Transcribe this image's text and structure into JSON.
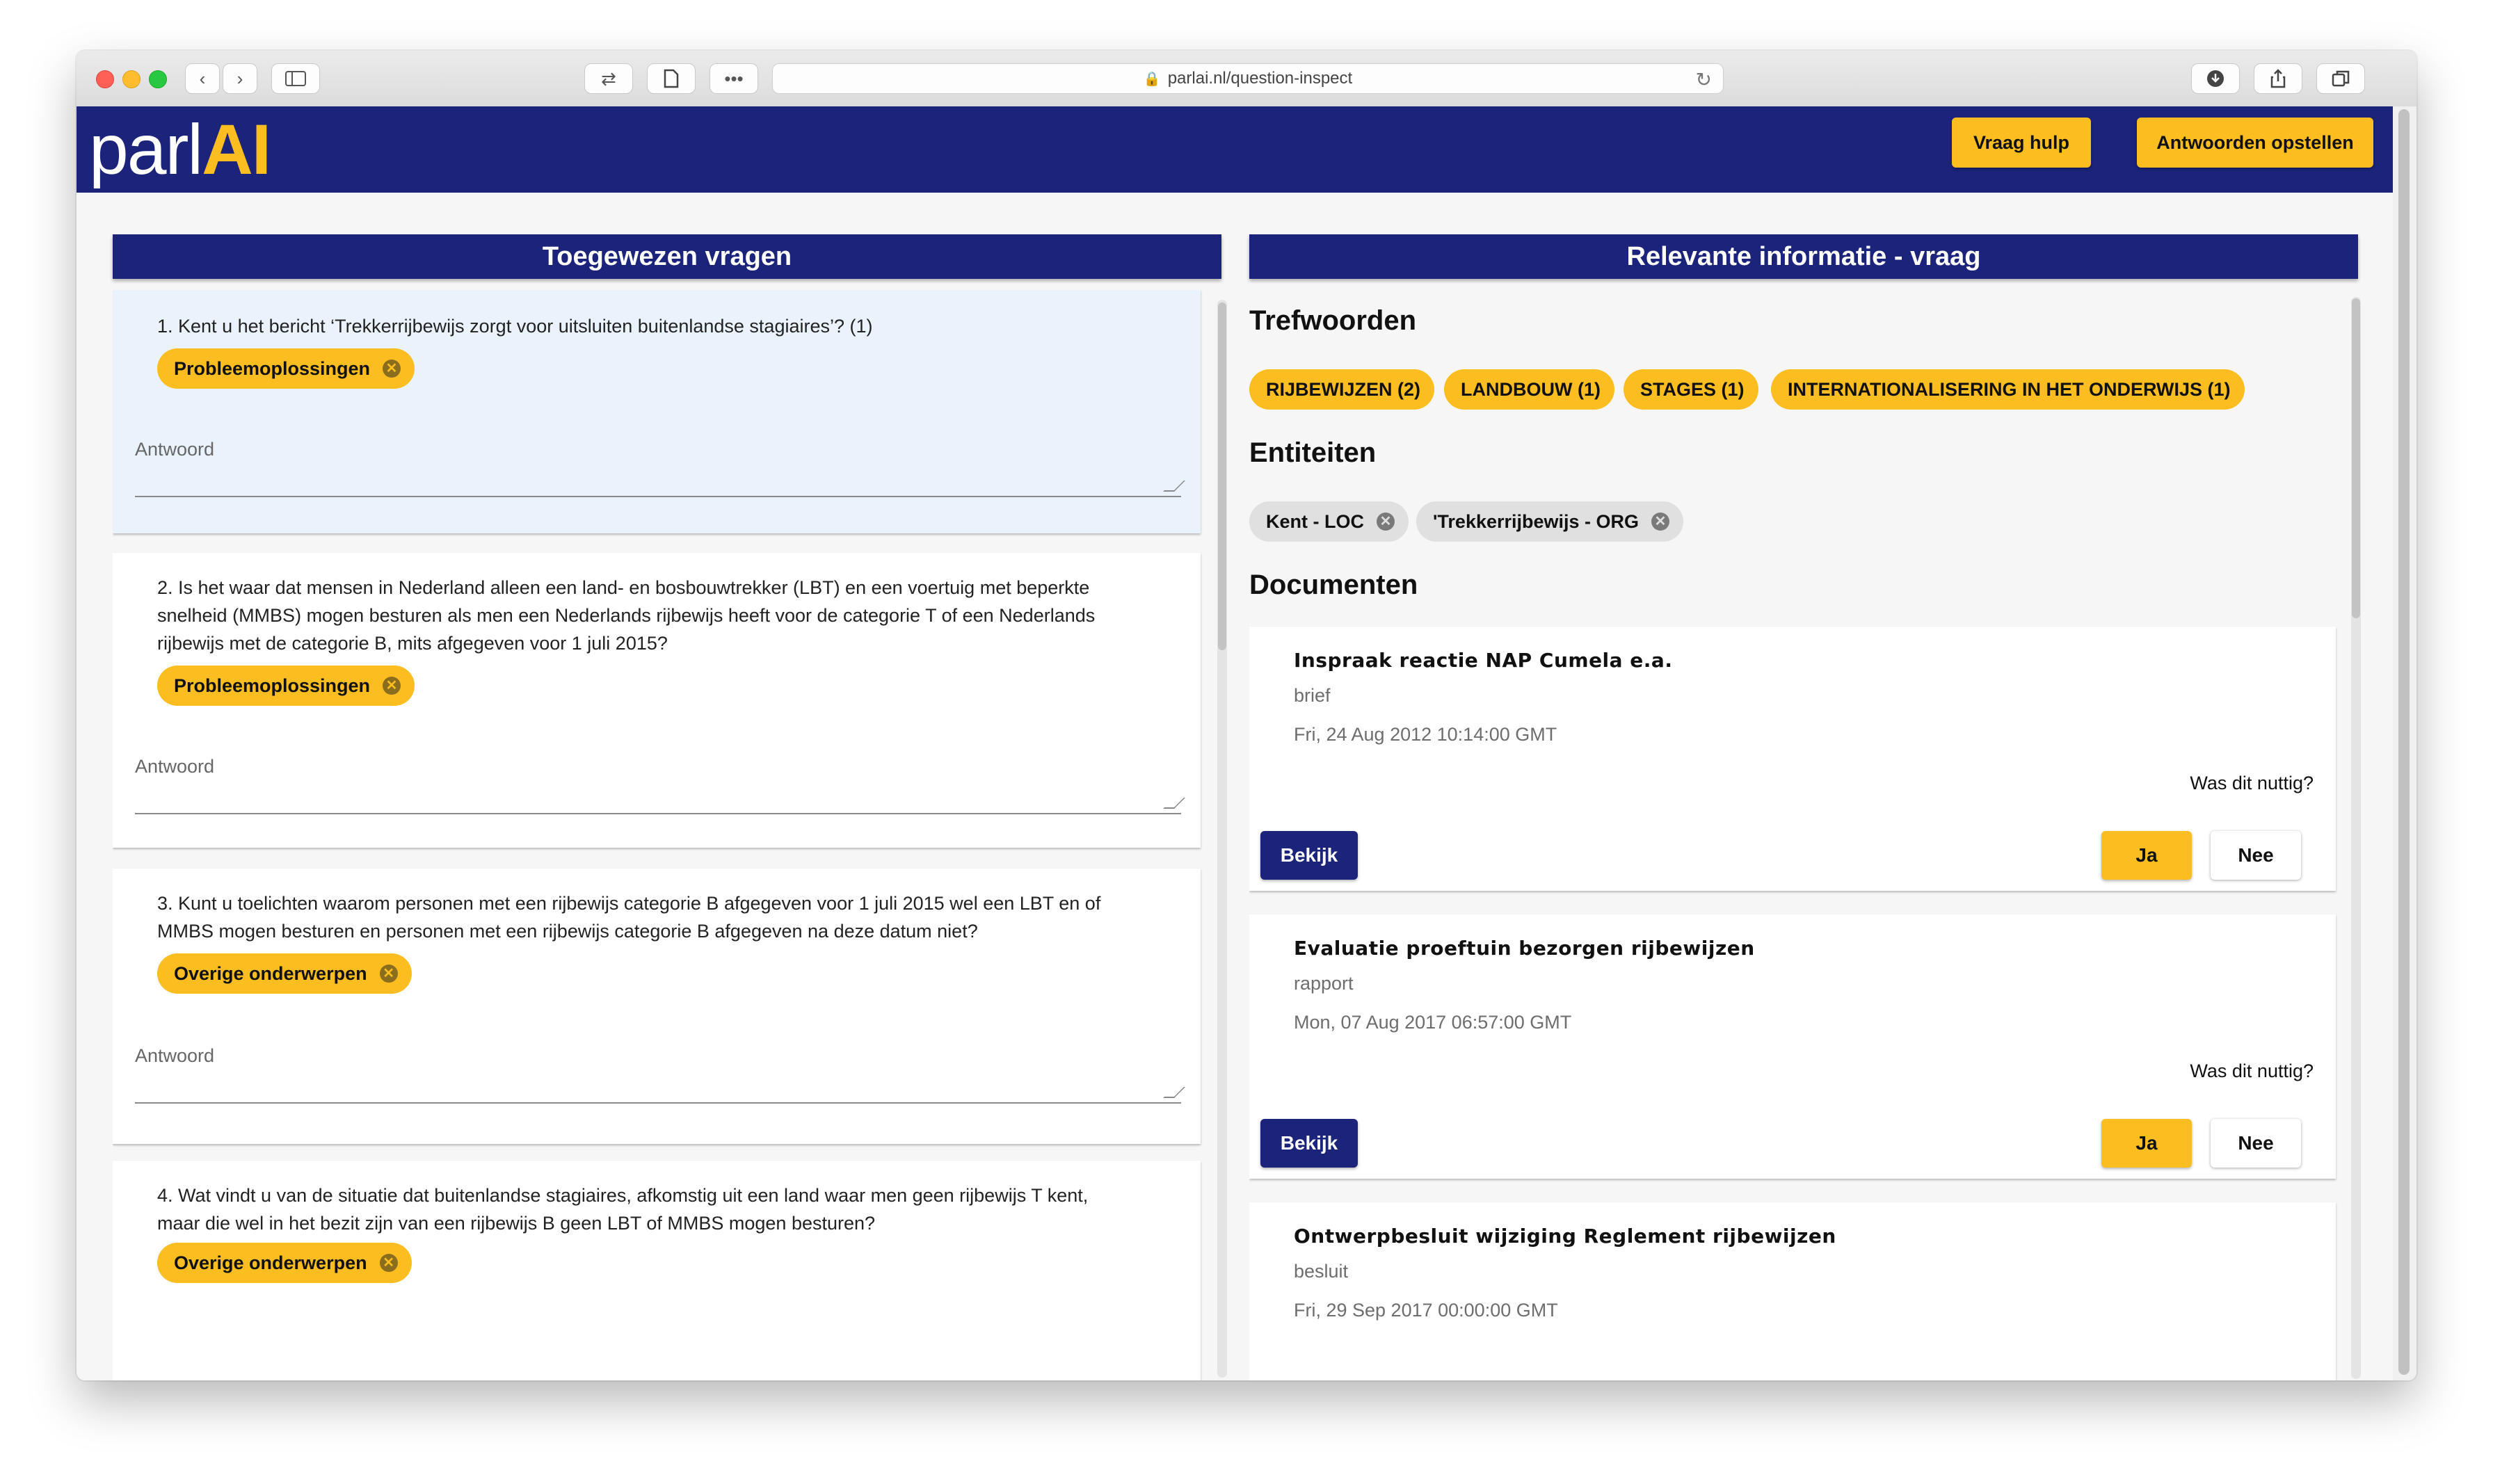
{
  "browser": {
    "url": "parlai.nl/question-inspect"
  },
  "header": {
    "logo_prefix": "parl",
    "logo_suffix": "AI",
    "help_button": "Vraag hulp",
    "compose_button": "Antwoorden opstellen"
  },
  "left_panel": {
    "title": "Toegewezen vragen",
    "answer_label": "Antwoord",
    "questions": [
      {
        "text": "1. Kent u het bericht ‘Trekkerrijbewijs zorgt voor uitsluiten buitenlandse stagiaires’? (1)",
        "tag": "Probleemoplossingen"
      },
      {
        "text": "2. Is het waar dat mensen in Nederland alleen een land- en bosbouwtrekker (LBT) en een voertuig met beperkte snelheid (MMBS) mogen besturen als men een Nederlands rijbewijs heeft voor de categorie T of een Nederlands rijbewijs met de categorie B, mits afgegeven voor 1 juli 2015?",
        "tag": "Probleemoplossingen"
      },
      {
        "text": "3. Kunt u toelichten waarom personen met een rijbewijs categorie B afgegeven voor 1 juli 2015 wel een LBT en of MMBS mogen besturen en personen met een rijbewijs categorie B afgegeven na deze datum niet?",
        "tag": "Overige onderwerpen"
      },
      {
        "text": "4. Wat vindt u van de situatie dat buitenlandse stagiaires, afkomstig uit een land waar men geen rijbewijs T kent, maar die wel in het bezit zijn van een rijbewijs B geen LBT of MMBS mogen besturen?",
        "tag": "Overige onderwerpen"
      }
    ]
  },
  "right_panel": {
    "title": "Relevante informatie - vraag",
    "keywords_title": "Trefwoorden",
    "keywords": [
      "RIJBEWIJZEN (2)",
      "LANDBOUW (1)",
      "STAGES (1)",
      "INTERNATIONALISERING IN HET ONDERWIJS (1)"
    ],
    "entities_title": "Entiteiten",
    "entities": [
      "Kent - LOC",
      "'Trekkerrijbewijs - ORG"
    ],
    "documents_title": "Documenten",
    "useful_question": "Was dit nuttig?",
    "view_label": "Bekijk",
    "yes_label": "Ja",
    "no_label": "Nee",
    "documents": [
      {
        "title": "Inspraak reactie NAP Cumela e.a.",
        "type": "brief",
        "date": "Fri, 24 Aug 2012 10:14:00 GMT"
      },
      {
        "title": "Evaluatie proeftuin bezorgen rijbewijzen",
        "type": "rapport",
        "date": "Mon, 07 Aug 2017 06:57:00 GMT"
      },
      {
        "title": "Ontwerpbesluit wijziging Reglement rijbewijzen",
        "type": "besluit",
        "date": "Fri, 29 Sep 2017 00:00:00 GMT"
      }
    ]
  },
  "colors": {
    "navy": "#1b237b",
    "accent": "#fbbd20"
  }
}
